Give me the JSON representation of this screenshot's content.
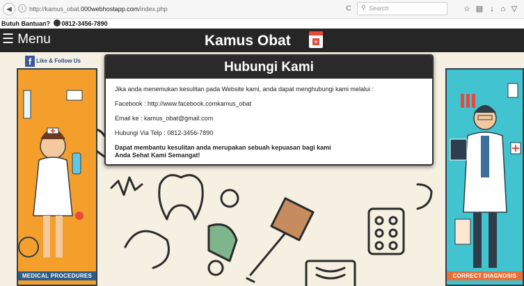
{
  "browser": {
    "url_prefix": "http://kamus_obat.",
    "url_domain": "000webhostapp.com",
    "url_path": "/index.php",
    "search_placeholder": "Search"
  },
  "help_bar": {
    "label": "Butuh Bantuan?",
    "phone": "0812-3456-7890"
  },
  "nav": {
    "menu_label": "☰ Menu",
    "site_title": "Kamus Obat"
  },
  "social": {
    "like_label": "Like & Follow Us"
  },
  "banners": {
    "left_caption": "MEDICAL PROCEDURES",
    "right_caption": "CORRECT DIAGNOSIS"
  },
  "modal": {
    "title": "Hubungi Kami",
    "intro": "Jika anda menemukan kesulitan pada Website kami, anda dapat menghubungi kami melalui :",
    "facebook": "Facebook : http://www.facebook.comkamus_obat",
    "email": "Email ke : kamus_obat@gmail.com",
    "phone": "Hubungi Via Telp : 0812-3456-7890",
    "closing_1": "Dapat membantu kesulitan anda merupakan sebuah kepuasan bagi kami",
    "closing_2": "Anda Sehat Kami Semangat!"
  },
  "colors": {
    "navbar": "#262626",
    "left_banner": "#f49f2b",
    "right_banner": "#41c4cf",
    "facebook": "#3b5998"
  }
}
